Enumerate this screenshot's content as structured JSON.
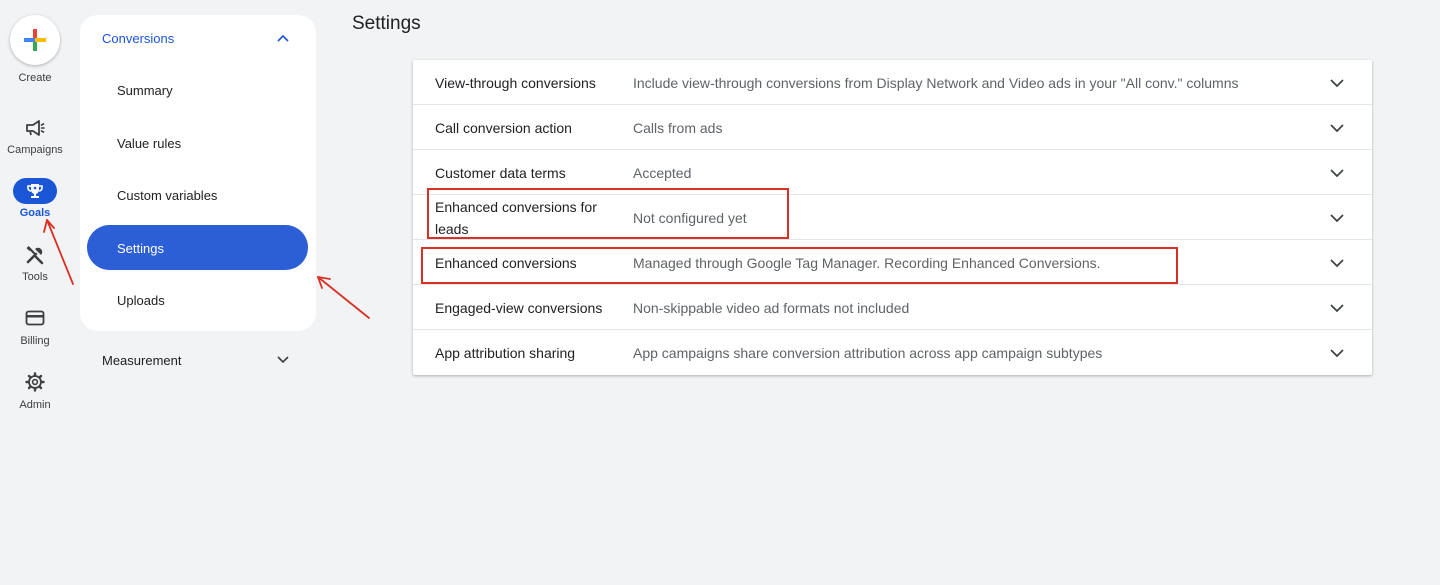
{
  "rail": {
    "create_label": "Create",
    "campaigns_label": "Campaigns",
    "goals_label": "Goals",
    "tools_label": "Tools",
    "billing_label": "Billing",
    "admin_label": "Admin",
    "icons": [
      "plus-icon",
      "megaphone-icon",
      "trophy-icon",
      "tools-icon",
      "billing-icon",
      "gear-icon"
    ]
  },
  "submenu": {
    "section": "Conversions",
    "items": [
      "Summary",
      "Value rules",
      "Custom variables",
      "Settings",
      "Uploads"
    ],
    "active": "Settings",
    "measurement": "Measurement"
  },
  "main": {
    "title": "Settings",
    "rows": [
      {
        "name": "View-through conversions",
        "value": "Include view-through conversions from Display Network and Video ads in your \"All conv.\" columns"
      },
      {
        "name": "Call conversion action",
        "value": "Calls from ads"
      },
      {
        "name": "Customer data terms",
        "value": "Accepted"
      },
      {
        "name": "Enhanced conversions for leads",
        "value": "Not configured yet"
      },
      {
        "name": "Enhanced conversions",
        "value": "Managed through Google Tag Manager. Recording Enhanced Conversions."
      },
      {
        "name": "Engaged-view conversions",
        "value": "Non-skippable video ad formats not included"
      },
      {
        "name": "App attribution sharing",
        "value": "App campaigns share conversion attribution across app campaign subtypes"
      }
    ]
  },
  "colors": {
    "accent": "#1a56d6",
    "active_pill": "#2c5fd5",
    "annotation": "#d93025",
    "background": "#f1f3f4"
  }
}
